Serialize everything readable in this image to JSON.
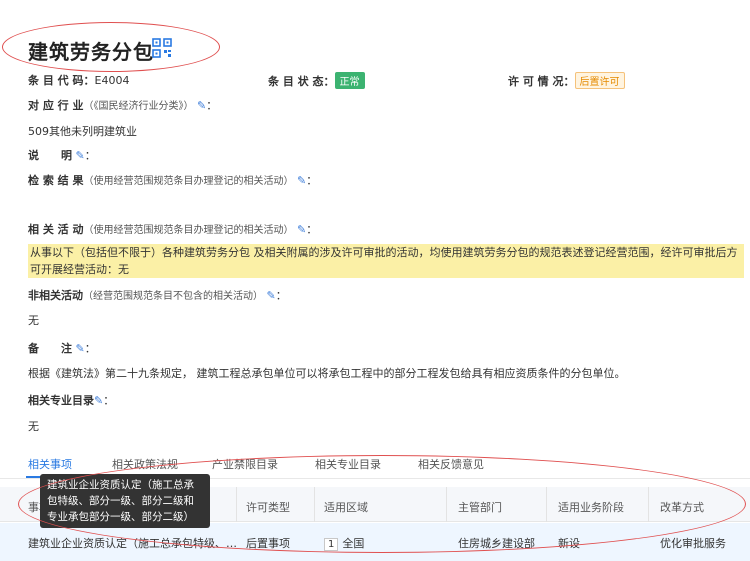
{
  "header": {
    "title": "建筑劳务分包"
  },
  "info": {
    "code_label": "条 目 代 码：",
    "code_value": "E4004",
    "status_label": "条 目 状 态：",
    "status_value": "正常",
    "status_color": "#3cb371",
    "permit_label": "许 可 情 况：",
    "permit_value": "后置许可",
    "permit_color": "#e58a00"
  },
  "industry": {
    "label": "对 应 行 业",
    "sub": "（《国民经济行业分类》）",
    "suffix": "：",
    "value": "509其他未列明建筑业"
  },
  "desc": {
    "label": "说　　明",
    "suffix": "："
  },
  "search_result": {
    "label": "检 索 结 果",
    "sub": "（使用经营范围规范条目办理登记的相关活动）",
    "suffix": "："
  },
  "related": {
    "label": "相 关 活 动",
    "sub": "（使用经营范围规范条目办理登记的相关活动）",
    "suffix": "：",
    "value": "从事以下（包括但不限于）各种建筑劳务分包 及相关附属的涉及许可审批的活动，均使用建筑劳务分包的规范表述登记经营范围，经许可审批后方可开展经营活动：无"
  },
  "non_related": {
    "label": "非相关活动",
    "sub": "（经营范围规范条目不包含的相关活动）",
    "suffix": "：",
    "value": "无"
  },
  "remark": {
    "label": "备　　注",
    "suffix": "：",
    "value": "根据《建筑法》第二十九条规定， 建筑工程总承包单位可以将承包工程中的部分工程发包给具有相应资质条件的分包单位。"
  },
  "major": {
    "label": "相关专业目录",
    "suffix": "：",
    "value": "无"
  },
  "tabs": [
    {
      "label": "相关事项"
    },
    {
      "label": "相关政策法规"
    },
    {
      "label": "产业禁限目录"
    },
    {
      "label": "相关专业目录"
    },
    {
      "label": "相关反馈意见"
    }
  ],
  "table": {
    "headers": [
      "事项",
      "许可类型",
      "适用区域",
      "主管部门",
      "适用业务阶段",
      "改革方式"
    ],
    "row": {
      "item": "建筑业企业资质认定（施工总承包特级、…",
      "permit_type": "后置事项",
      "region_num": "1",
      "region": "全国",
      "dept": "住房城乡建设部",
      "stage": "新设",
      "reform": "优化审批服务"
    }
  },
  "tooltip": {
    "text": "建筑业企业资质认定（施工总承包特级、部分一级、部分二级和专业承包部分一级、部分二级）"
  },
  "accent": "#2a7ae2"
}
